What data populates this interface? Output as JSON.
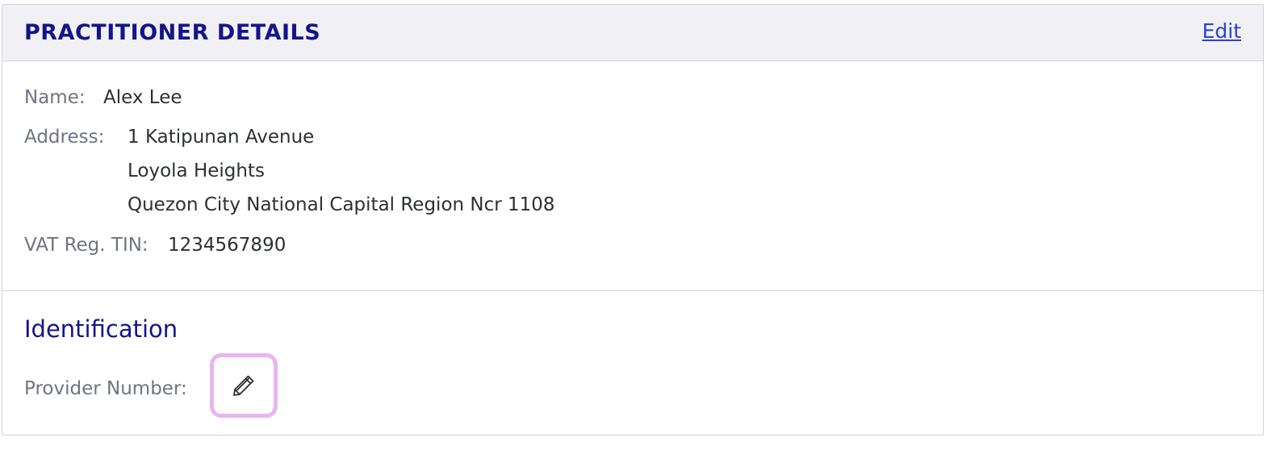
{
  "header": {
    "title": "PRACTITIONER DETAILS",
    "edit_label": "Edit"
  },
  "details": {
    "name_label": "Name:",
    "name_value": "Alex Lee",
    "address_label": "Address:",
    "address_lines": [
      "1 Katipunan Avenue",
      "Loyola Heights",
      "Quezon City National Capital Region Ncr 1108"
    ],
    "vat_label": "VAT Reg. TIN:",
    "vat_value": "1234567890"
  },
  "identification": {
    "title": "Identification",
    "provider_label": "Provider Number:",
    "provider_edit_icon": "pencil-icon"
  },
  "colors": {
    "title": "#14148a",
    "link": "#2b3fd6",
    "header_bg": "#f1f1f5",
    "label": "#6e7480",
    "value": "#2c2f36",
    "focus_ring": "#e9b5f0"
  }
}
